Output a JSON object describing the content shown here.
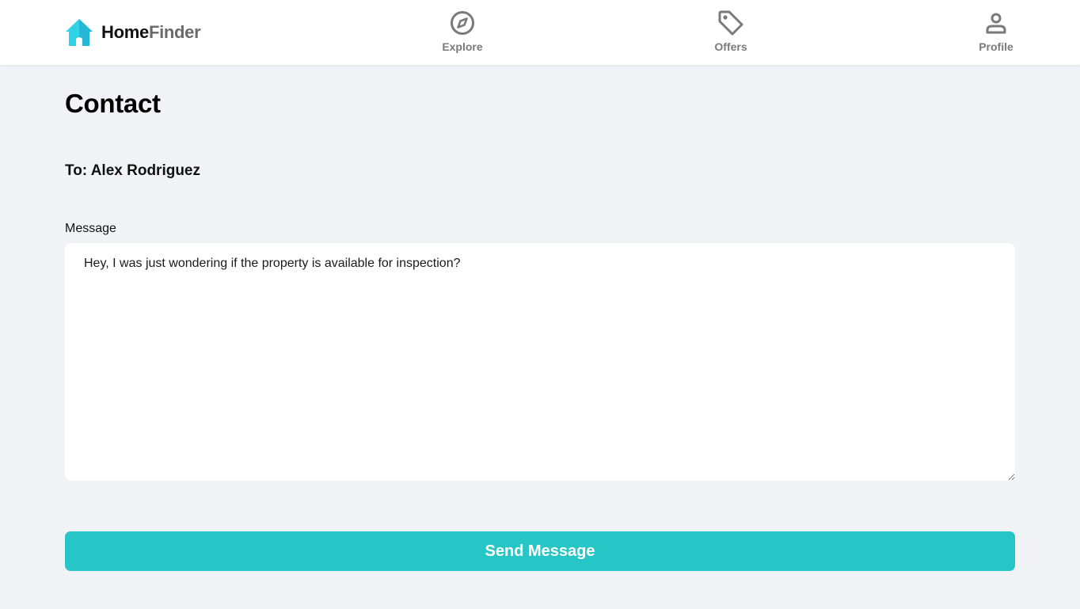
{
  "brand": {
    "name_part1": "Home",
    "name_part2": "Finder",
    "logo_icon": "house-icon",
    "logo_color": "#2fd3e6"
  },
  "nav": {
    "items": [
      {
        "label": "Explore",
        "icon": "compass-icon"
      },
      {
        "label": "Offers",
        "icon": "tag-icon"
      },
      {
        "label": "Profile",
        "icon": "user-icon"
      }
    ]
  },
  "page": {
    "title": "Contact",
    "recipient": "To: Alex Rodriguez"
  },
  "form": {
    "message_label": "Message",
    "message_value": "Hey, I was just wondering if the property is available for inspection?",
    "submit_label": "Send Message"
  },
  "colors": {
    "accent": "#26c6c6",
    "background": "#f2f3f7",
    "nav_icon": "#7a7a7a"
  }
}
